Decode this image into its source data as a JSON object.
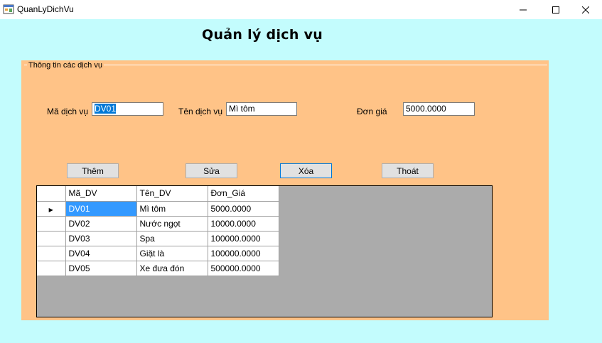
{
  "window": {
    "title": "QuanLyDichVu",
    "minimize_glyph": "—",
    "maximize_glyph": "☐",
    "close_glyph": "✕"
  },
  "heading": "Quản lý dịch vụ",
  "group_title": "Thông tin các dịch vụ",
  "form": {
    "ma_label": "Mã dịch vụ",
    "ma_value": "DV01",
    "ten_label": "Tên dịch vụ",
    "ten_value": "Mì tôm",
    "gia_label": "Đơn giá",
    "gia_value": "5000.0000"
  },
  "buttons": {
    "add": "Thêm",
    "edit": "Sửa",
    "delete": "Xóa",
    "exit": "Thoát"
  },
  "grid": {
    "columns": [
      "Mã_DV",
      "Tên_DV",
      "Đơn_Giá"
    ],
    "current_row_marker": "▶",
    "rows": [
      [
        "DV01",
        "Mì tôm",
        "5000.0000"
      ],
      [
        "DV02",
        "Nước ngọt",
        "10000.0000"
      ],
      [
        "DV03",
        "Spa",
        "100000.0000"
      ],
      [
        "DV04",
        "Giặt là",
        "100000.0000"
      ],
      [
        "DV05",
        "Xe đưa đón",
        "500000.0000"
      ]
    ]
  },
  "colors": {
    "background": "#c3fcfd",
    "groupbox": "#ffc387",
    "selection": "#0078d7",
    "grid_empty": "#ababab"
  }
}
